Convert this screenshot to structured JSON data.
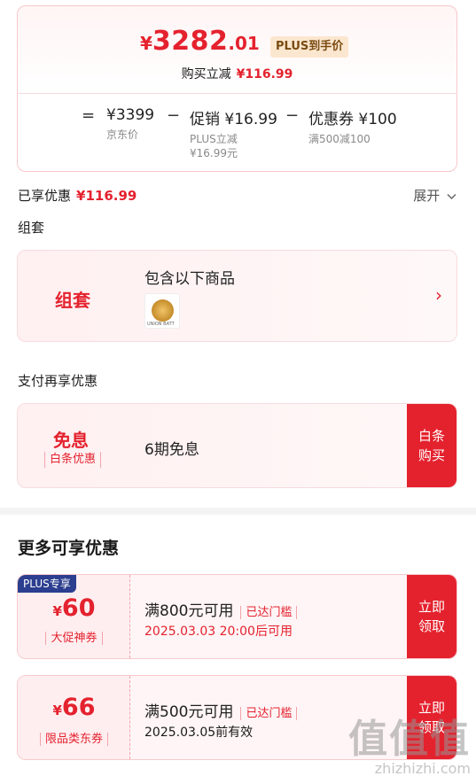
{
  "price_card": {
    "currency": "¥",
    "price_int": "3282",
    "price_dec": ".01",
    "plus_tag": "PLUS到手价",
    "reduce_label": "购买立减",
    "reduce_amount": "¥116.99",
    "breakdown": {
      "equals": "=",
      "minus": "−",
      "jd_price": "¥3399",
      "jd_label": "京东价",
      "promo_value": "促销 ¥16.99",
      "promo_line1": "PLUS立减",
      "promo_line2": "¥16.99元",
      "coupon_value": "优惠券 ¥100",
      "coupon_label": "满500减100"
    }
  },
  "enjoyed": {
    "label": "已享优惠",
    "amount": "¥116.99",
    "expand": "展开"
  },
  "bundle_section": {
    "title": "组套",
    "card_label": "组套",
    "card_text": "包含以下商品",
    "thumb_text": "UNION BATT"
  },
  "pay_section": {
    "title": "支付再享优惠",
    "label": "免息",
    "sub": "白条优惠",
    "text": "6期免息",
    "button": "白条购买"
  },
  "more_section": {
    "title": "更多可享优惠",
    "coupons": [
      {
        "plus_tag": "PLUS专享",
        "currency": "¥",
        "amount": "60",
        "tag": "大促神券",
        "condition": "满800元可用",
        "reach": "已达门槛",
        "validity": "2025.03.03 20:00后可用",
        "button": "立即领取"
      },
      {
        "currency": "¥",
        "amount": "66",
        "tag": "限品类东券",
        "condition": "满500元可用",
        "reach": "已达门槛",
        "validity": "2025.03.05前有效",
        "button": "立即领取"
      }
    ]
  },
  "watermark": {
    "big": "值值值",
    "small": "zhizhizhi.com"
  }
}
